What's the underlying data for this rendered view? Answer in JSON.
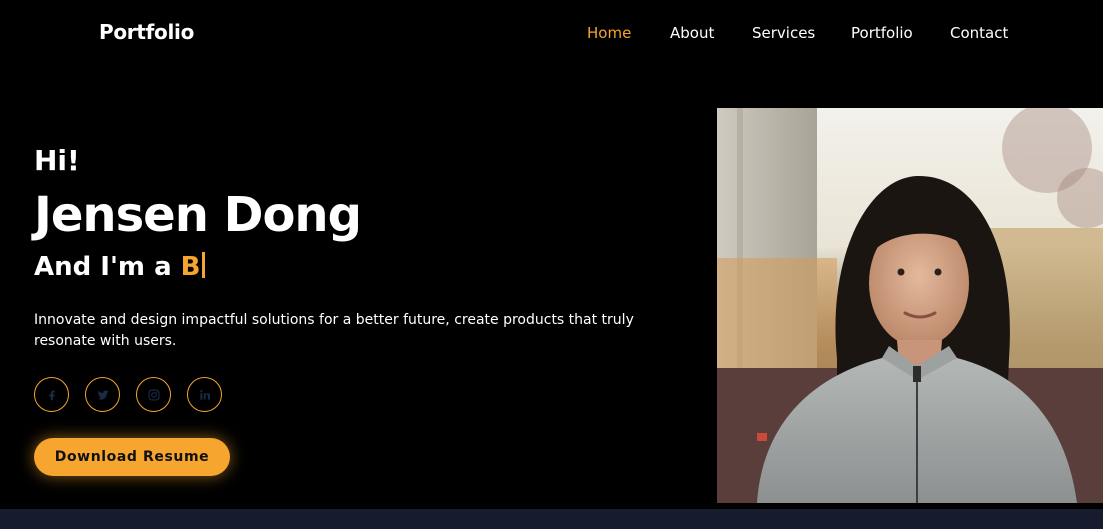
{
  "navbar": {
    "logo": "Portfolio",
    "links": [
      {
        "label": "Home",
        "active": true
      },
      {
        "label": "About",
        "active": false
      },
      {
        "label": "Services",
        "active": false
      },
      {
        "label": "Portfolio",
        "active": false
      },
      {
        "label": "Contact",
        "active": false
      }
    ]
  },
  "hero": {
    "greeting": "Hi!",
    "name": "Jensen Dong",
    "role_prefix": "And I'm a ",
    "role_typed": "B",
    "description": "Innovate and design impactful solutions for a better future, create products that truly resonate with users.",
    "socials": [
      {
        "icon": "facebook-icon"
      },
      {
        "icon": "twitter-icon"
      },
      {
        "icon": "instagram-icon"
      },
      {
        "icon": "linkedin-icon"
      }
    ],
    "download_label": "Download Resume"
  },
  "colors": {
    "accent": "#f6a52e",
    "background": "#000000",
    "footer_band": "#161c2d"
  }
}
